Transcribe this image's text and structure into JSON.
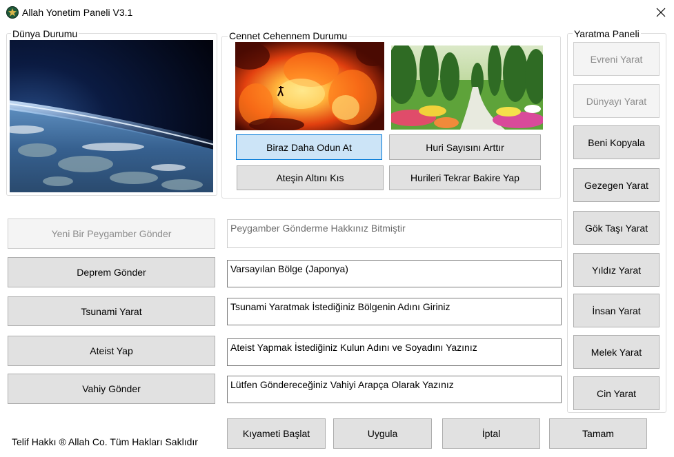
{
  "window": {
    "title": "Allah Yonetim Paneli V3.1",
    "icon": "app-emblem-icon",
    "close_glyph": "✕"
  },
  "world_status": {
    "label": "Dünya Durumu",
    "image": "earth-orbit-image"
  },
  "heaven_hell": {
    "label": "Cennet Cehennem Durumu",
    "hell_image": "hell-fire-image",
    "heaven_image": "heaven-garden-image",
    "buttons": {
      "add_wood": "Biraz Daha Odun At",
      "increase_huri": "Huri Sayısını Arttır",
      "lower_fire": "Ateşin Altını Kıs",
      "reset_huri": "Hurileri Tekrar Bakire Yap"
    }
  },
  "actions": {
    "send_prophet": {
      "label": "Yeni Bir Peygamber Gönder",
      "field": "Peygamber Gönderme Hakkınız Bitmiştir"
    },
    "earthquake": {
      "label": "Deprem Gönder",
      "field": "Varsayılan Bölge (Japonya)"
    },
    "tsunami": {
      "label": "Tsunami Yarat",
      "field": "Tsunami Yaratmak İstediğiniz Bölgenin Adını Giriniz"
    },
    "atheist": {
      "label": "Ateist Yap",
      "field": "Ateist Yapmak İstediğiniz Kulun Adını ve Soyadını Yazınız"
    },
    "revelation": {
      "label": "Vahiy Gönder",
      "field": "Lütfen Göndereceğiniz Vahiyi Arapça Olarak Yazınız"
    }
  },
  "creation_panel": {
    "label": "Yaratma Paneli",
    "buttons": [
      "Evreni Yarat",
      "Dünyayı Yarat",
      "Beni Kopyala",
      "Gezegen Yarat",
      "Gök Taşı Yarat",
      "Yıldız Yarat",
      "İnsan Yarat",
      "Melek Yarat",
      "Cin Yarat"
    ]
  },
  "bottom_buttons": {
    "apocalypse": "Kıyameti Başlat",
    "apply": "Uygula",
    "cancel": "İptal",
    "ok": "Tamam"
  },
  "footer": "Telif Hakkı ® Allah Co. Tüm Hakları Saklıdır"
}
